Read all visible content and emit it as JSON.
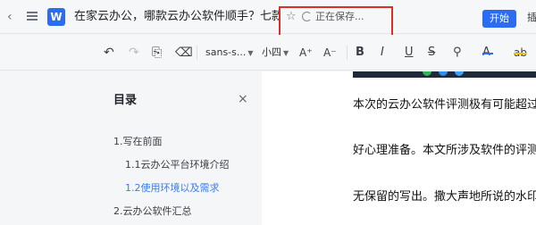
{
  "titlebar": {
    "back_glyph": "‹",
    "logo_letter": "W",
    "doc_title": "在家云办公，哪款云办公软件顺手？七款...",
    "save_status": "正在保存...",
    "start_button": "开始",
    "cut_text": "插"
  },
  "toolbar": {
    "undo": "↶",
    "redo": "↷",
    "format_painter": "⎘",
    "eraser": "⌫",
    "font_family": "sans-s...",
    "font_size": "小四",
    "font_grow": "A⁺",
    "font_shrink": "A⁻",
    "bold": "B",
    "italic": "I",
    "underline": "U",
    "strike": "S",
    "clear": "⚲",
    "font_color": "A",
    "highlight": "ab",
    "colors": {
      "font_color_bar": "#2b6cf3",
      "highlight_bar": "#f5c400"
    }
  },
  "toc": {
    "title": "目录",
    "close": "×",
    "items": [
      {
        "label": "1.写在前面"
      },
      {
        "label": "1.1云办公平台环境介绍"
      },
      {
        "label": "1.2使用环境以及需求"
      },
      {
        "label": "2.云办公软件汇总"
      }
    ]
  },
  "document": {
    "paragraphs": [
      "本次的云办公软件评测极有可能超过",
      "好心理准备。本文所涉及软件的评测",
      "无保留的写出。撒大声地所说的水印"
    ]
  },
  "colors": {
    "accent": "#2b6cf3",
    "active_toc": "#3b7cf6",
    "highlight_box": "#d93025"
  }
}
